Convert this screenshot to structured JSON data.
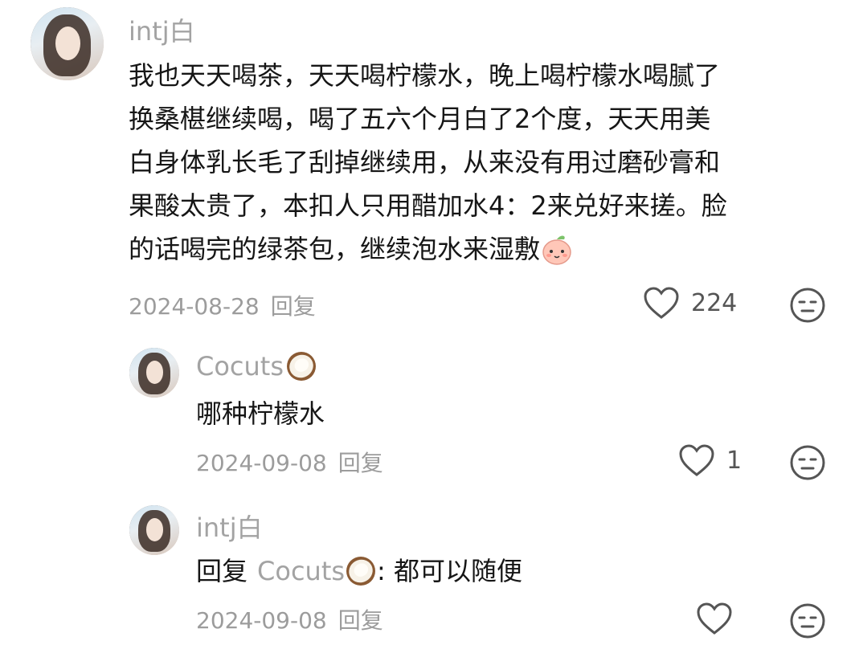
{
  "comments": [
    {
      "username": "intj白",
      "text_lines": [
        "我也天天喝茶，天天喝柠檬水，晚上喝柠檬水喝腻了",
        "换桑椹继续喝，喝了五六个月白了2个度，天天用美",
        "白身体乳长毛了刮掉继续用，从来没有用过磨砂膏和",
        "果酸太贵了，本扣人只用醋加水4：2来兑好来搓。脸",
        "的话喝完的绿茶包，继续泡水来湿敷"
      ],
      "date": "2024-08-28",
      "reply_label": "回复",
      "likes": "224",
      "emoji": "peach-face"
    },
    {
      "username": "Cocuts",
      "username_emoji": "coconut",
      "text": "哪种柠檬水",
      "date": "2024-09-08",
      "reply_label": "回复",
      "likes": "1"
    },
    {
      "username": "intj白",
      "reply_prefix": "回复",
      "reply_to": "Cocuts",
      "reply_to_emoji": "coconut",
      "reply_text": ": 都可以随便",
      "date": "2024-09-08",
      "reply_label": "回复",
      "likes": ""
    }
  ],
  "icons": {
    "like": "heart-outline-icon",
    "dislike": "meh-face-icon"
  },
  "colors": {
    "text": "#161616",
    "secondary": "#a3a3a3",
    "icon": "#555555"
  }
}
